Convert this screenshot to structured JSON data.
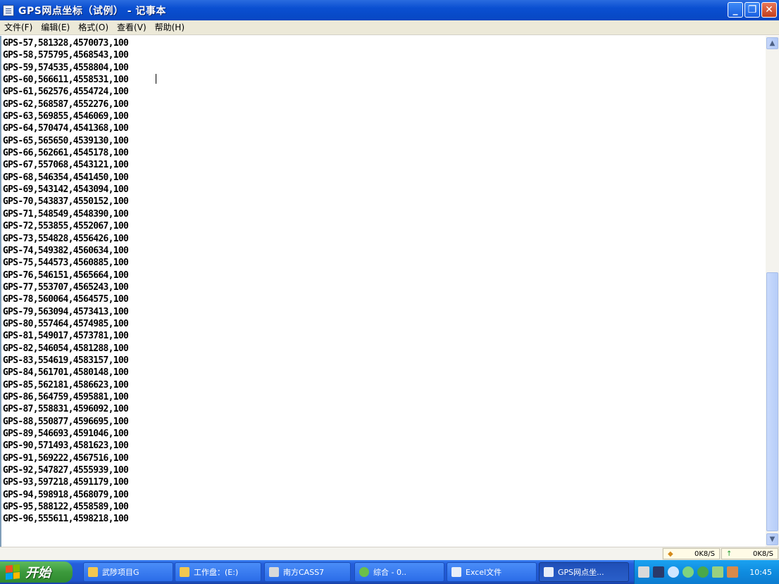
{
  "window": {
    "title": "GPS网点坐标（试例） - 记事本",
    "minimize_icon": "minimize-icon",
    "maximize_icon": "restore-icon",
    "close_icon": "close-icon"
  },
  "menu": [
    {
      "label": "文件(F)"
    },
    {
      "label": "编辑(E)"
    },
    {
      "label": "格式(O)"
    },
    {
      "label": "查看(V)"
    },
    {
      "label": "帮助(H)"
    }
  ],
  "lines": [
    "GPS-57,581328,4570073,100",
    "GPS-58,575795,4568543,100",
    "GPS-59,574535,4558804,100",
    "GPS-60,566611,4558531,100",
    "GPS-61,562576,4554724,100",
    "GPS-62,568587,4552276,100",
    "GPS-63,569855,4546069,100",
    "GPS-64,570474,4541368,100",
    "GPS-65,565650,4539130,100",
    "GPS-66,562661,4545178,100",
    "GPS-67,557068,4543121,100",
    "GPS-68,546354,4541450,100",
    "GPS-69,543142,4543094,100",
    "GPS-70,543837,4550152,100",
    "GPS-71,548549,4548390,100",
    "GPS-72,553855,4552067,100",
    "GPS-73,554828,4556426,100",
    "GPS-74,549382,4560634,100",
    "GPS-75,544573,4560885,100",
    "GPS-76,546151,4565664,100",
    "GPS-77,553707,4565243,100",
    "GPS-78,560064,4564575,100",
    "GPS-79,563094,4573413,100",
    "GPS-80,557464,4574985,100",
    "GPS-81,549017,4573781,100",
    "GPS-82,546054,4581288,100",
    "GPS-83,554619,4583157,100",
    "GPS-84,561701,4580148,100",
    "GPS-85,562181,4586623,100",
    "GPS-86,564759,4595881,100",
    "GPS-87,558831,4596092,100",
    "GPS-88,550877,4596695,100",
    "GPS-89,546693,4591046,100",
    "GPS-90,571493,4581623,100",
    "GPS-91,569222,4567516,100",
    "GPS-92,547827,4555939,100",
    "GPS-93,597218,4591179,100",
    "GPS-94,598918,4568079,100",
    "GPS-95,588122,4558589,100",
    "GPS-96,555611,4598218,100"
  ],
  "status": {
    "cell1": "0K8/S",
    "cell2": "0K8/S"
  },
  "taskbar": {
    "start_label": "开始",
    "tasks": [
      {
        "label": "武陟项目G"
      },
      {
        "label": "工作盘：(E:)"
      },
      {
        "label": "南方CASS7"
      },
      {
        "label": "综合 - 0.."
      },
      {
        "label": "Excel文件"
      },
      {
        "label": "GPS网点坐..."
      }
    ],
    "clock": "10:45"
  },
  "colors": {
    "titlebar": "#0a4fd1",
    "taskbar": "#245edb",
    "start": "#3c9a3c",
    "tray": "#0f8ce0",
    "close": "#c3401d"
  }
}
